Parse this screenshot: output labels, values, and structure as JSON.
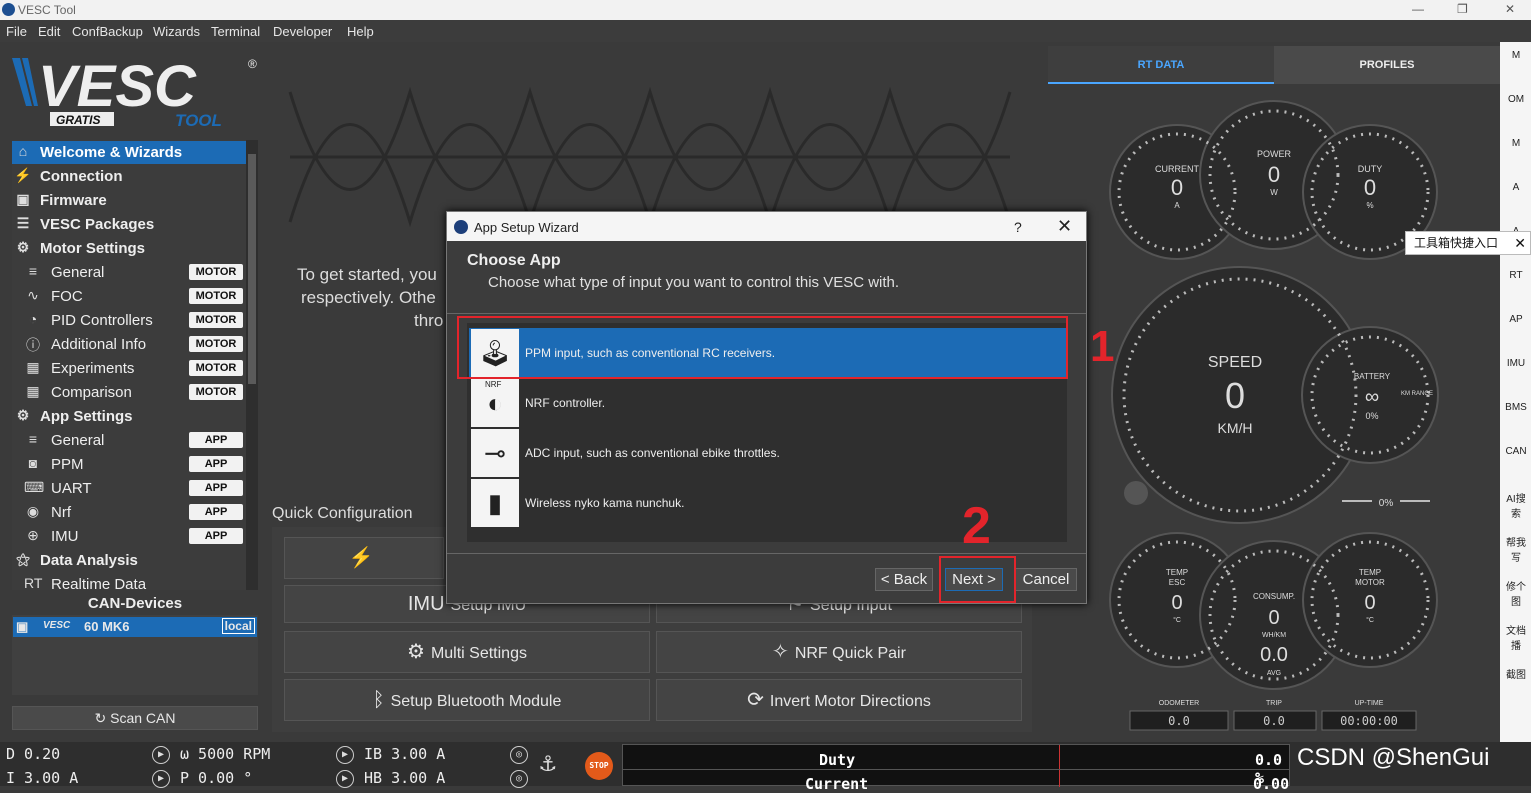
{
  "window": {
    "title": "VESC Tool"
  },
  "menu": [
    "File",
    "Edit",
    "ConfBackup",
    "Wizards",
    "Terminal",
    "Developer",
    "Help"
  ],
  "logo": {
    "brand": "VESC",
    "sub1": "GRATIS",
    "sub2": "TOOL",
    "reg": "®"
  },
  "nav": [
    {
      "label": "Welcome & Wizards",
      "top": true,
      "icon": "home-icon",
      "glyph": "⌂"
    },
    {
      "label": "Connection",
      "top": true,
      "icon": "plug-icon",
      "glyph": "⚡"
    },
    {
      "label": "Firmware",
      "top": true,
      "icon": "chip-icon",
      "glyph": "▣"
    },
    {
      "label": "VESC Packages",
      "top": true,
      "icon": "package-icon",
      "glyph": "☰"
    },
    {
      "label": "Motor Settings",
      "top": true,
      "icon": "motor-icon",
      "glyph": "⚙"
    },
    {
      "label": "General",
      "badge": "MOTOR",
      "icon": "sliders-icon",
      "glyph": "≡"
    },
    {
      "label": "FOC",
      "badge": "MOTOR",
      "icon": "foc-icon",
      "glyph": "∿"
    },
    {
      "label": "PID Controllers",
      "badge": "MOTOR",
      "icon": "gauge-icon",
      "glyph": "◔"
    },
    {
      "label": "Additional Info",
      "badge": "MOTOR",
      "icon": "info-icon",
      "glyph": "ⓘ"
    },
    {
      "label": "Experiments",
      "badge": "MOTOR",
      "icon": "calculator-icon",
      "glyph": "▦"
    },
    {
      "label": "Comparison",
      "badge": "MOTOR",
      "icon": "calculator-icon",
      "glyph": "▦"
    },
    {
      "label": "App Settings",
      "top": true,
      "icon": "app-settings-icon",
      "glyph": "⚙"
    },
    {
      "label": "General",
      "badge": "APP",
      "icon": "sliders-icon",
      "glyph": "≡"
    },
    {
      "label": "PPM",
      "badge": "APP",
      "icon": "gamepad-icon",
      "glyph": "◙"
    },
    {
      "label": "UART",
      "badge": "APP",
      "icon": "keyboard-icon",
      "glyph": "⌨"
    },
    {
      "label": "Nrf",
      "badge": "APP",
      "icon": "wireless-icon",
      "glyph": "◉"
    },
    {
      "label": "IMU",
      "badge": "APP",
      "icon": "imu-icon",
      "glyph": "⊕"
    },
    {
      "label": "Data Analysis",
      "top": true,
      "icon": "analysis-icon",
      "glyph": "⚝"
    },
    {
      "label": "Realtime Data",
      "icon": "rt-icon",
      "glyph": "RT"
    }
  ],
  "can": {
    "title": "CAN-Devices",
    "device": "60 MK6",
    "brand": "VESC",
    "tag": "local",
    "scan_label": "Scan CAN"
  },
  "welcome": {
    "line1": "To get started, you",
    "line2": "respectively. Othe",
    "line3": "thro"
  },
  "quick": {
    "title": "Quick Configuration",
    "buttons": {
      "setup_imu": "Setup IMU",
      "setup_input": "Setup Input",
      "multi": "Multi Settings",
      "nrf": "NRF Quick Pair",
      "bt": "Setup Bluetooth Module",
      "invert": "Invert Motor Directions"
    }
  },
  "right_tabs": {
    "rt": "RT DATA",
    "profiles": "PROFILES"
  },
  "gauges": {
    "current": {
      "label": "CURRENT",
      "value": "0",
      "unit": "A"
    },
    "power": {
      "label": "POWER",
      "value": "0",
      "unit": "W"
    },
    "duty": {
      "label": "DUTY",
      "value": "0",
      "unit": "%"
    },
    "speed": {
      "label": "SPEED",
      "value": "0",
      "unit": "KM/H"
    },
    "battery": {
      "label": "BATTERY",
      "value": "∞",
      "pct": "0%",
      "range_label": "KM RANGE"
    },
    "bar_pct": "0%",
    "temp_esc": {
      "label1": "TEMP",
      "label2": "ESC",
      "value": "0",
      "unit": "°C"
    },
    "consump": {
      "label": "CONSUMP.",
      "value": "0",
      "unit": "WH/KM",
      "avg": "0.0",
      "avg_label": "AVG"
    },
    "temp_motor": {
      "label1": "TEMP",
      "label2": "MOTOR",
      "value": "0",
      "unit": "°C"
    },
    "odometer": {
      "label": "ODOMETER",
      "value": "0.0"
    },
    "trip": {
      "label": "TRIP",
      "value": "0.0"
    },
    "uptime": {
      "label": "UP-TIME",
      "value": "00:00:00"
    }
  },
  "dialog": {
    "title": "App Setup Wizard",
    "help": "?",
    "heading": "Choose App",
    "subtitle": "Choose what type of input you want to control this VESC with.",
    "options": [
      {
        "label": "PPM input, such as conventional RC receivers.",
        "icon": "rc-transmitter-icon",
        "glyph": "🕹",
        "selected": true
      },
      {
        "label": "NRF controller.",
        "icon": "nrf-remote-icon",
        "glyph": "◐",
        "tag": "NRF"
      },
      {
        "label": "ADC input, such as conventional ebike throttles.",
        "icon": "throttle-icon",
        "glyph": "⊸"
      },
      {
        "label": "Wireless nyko kama nunchuk.",
        "icon": "nunchuk-icon",
        "glyph": "▮"
      }
    ],
    "back": "< Back",
    "next": "Next >",
    "cancel": "Cancel"
  },
  "annotations": {
    "one": "1",
    "two": "2"
  },
  "tooltip": "工具箱快捷入口",
  "toolstrip": [
    "M",
    "OM",
    "M",
    "A",
    "A",
    "RT",
    "AP",
    "IMU",
    "BMS",
    "CAN",
    "AI搜索",
    "帮我写",
    "修个图",
    "文档播",
    "截图"
  ],
  "bottom": {
    "d": "D 0.20",
    "w": "ω 5000 RPM",
    "ib": "IB 3.00 A",
    "i": "I 3.00 A",
    "p": "P 0.00 °",
    "hb": "HB 3.00 A",
    "stop": "STOP",
    "duty_label": "Duty",
    "duty_value": "0.0 %",
    "current_label": "Current",
    "current_value": "0.00"
  },
  "watermark": "CSDN @ShenGui",
  "colors": {
    "accent": "#1c6bb5",
    "annotation": "#e3242b",
    "gauge_blue": "#4aa6ff"
  }
}
